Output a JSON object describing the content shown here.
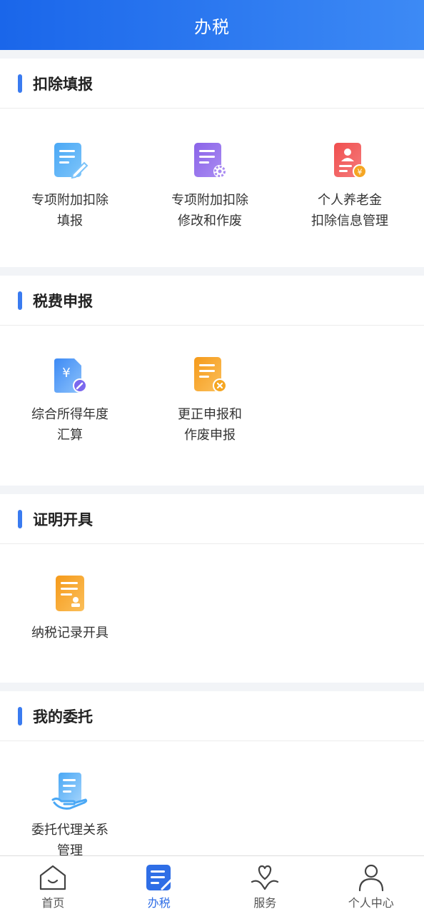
{
  "header": {
    "title": "办税"
  },
  "sections": [
    {
      "title": "扣除填报",
      "items": [
        {
          "label": "专项附加扣除\n填报",
          "icon": "doc-edit-icon"
        },
        {
          "label": "专项附加扣除\n修改和作废",
          "icon": "doc-settings-icon"
        },
        {
          "label": "个人养老金\n扣除信息管理",
          "icon": "pension-icon"
        }
      ]
    },
    {
      "title": "税费申报",
      "items": [
        {
          "label": "综合所得年度\n汇算",
          "icon": "yuan-doc-icon"
        },
        {
          "label": "更正申报和\n作废申报",
          "icon": "doc-cancel-icon"
        }
      ]
    },
    {
      "title": "证明开具",
      "items": [
        {
          "label": "纳税记录开具",
          "icon": "tax-record-icon"
        }
      ]
    },
    {
      "title": "我的委托",
      "items": [
        {
          "label": "委托代理关系\n管理",
          "icon": "delegation-icon"
        }
      ]
    }
  ],
  "tabbar": {
    "items": [
      {
        "label": "首页",
        "icon": "home-icon"
      },
      {
        "label": "办税",
        "icon": "tax-icon",
        "active": true
      },
      {
        "label": "服务",
        "icon": "service-icon"
      },
      {
        "label": "个人中心",
        "icon": "person-icon"
      }
    ]
  },
  "colors": {
    "accent": "#2f6ee6",
    "header_start": "#1a66ea",
    "header_end": "#3d8af5"
  }
}
